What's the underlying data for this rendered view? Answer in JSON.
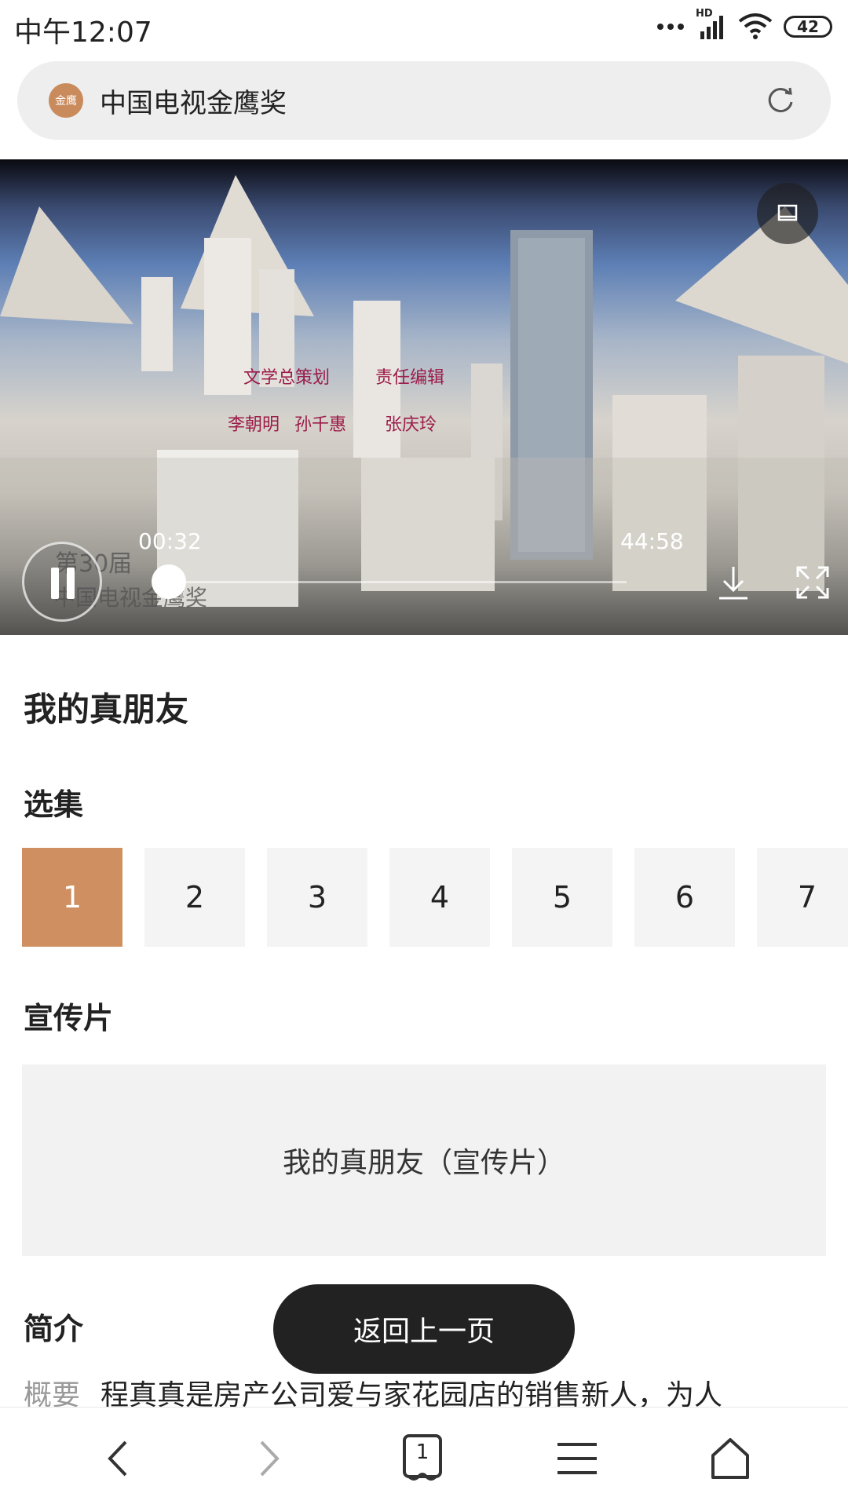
{
  "status_bar": {
    "time": "中午12:07",
    "network_badge": "HD",
    "battery": "42",
    "icons": [
      "more-dots-icon",
      "signal-icon",
      "wifi-icon",
      "battery-icon"
    ]
  },
  "address_bar": {
    "site_logo": "金鹰",
    "title": "中国电视金鹰奖",
    "reload_icon": "reload-icon"
  },
  "player": {
    "current_time": "00:32",
    "total_time": "44:58",
    "progress": 0.012,
    "controls": [
      "pause-icon",
      "download-icon",
      "fullscreen-icon",
      "picture-in-picture-icon"
    ]
  },
  "show": {
    "title": "我的真朋友"
  },
  "episodes": {
    "heading": "选集",
    "items": [
      "1",
      "2",
      "3",
      "4",
      "5",
      "6",
      "7"
    ],
    "active_index": 0
  },
  "trailer": {
    "heading": "宣传片",
    "item": "我的真朋友（宣传片）"
  },
  "intro": {
    "heading": "简介",
    "label": "概要",
    "text": "程真真是房产公司爱与家花园店的销售新人，为人"
  },
  "toast": "返回上一页",
  "bottom_nav": {
    "tab_count": "1",
    "items": [
      "back-icon",
      "forward-icon",
      "tabs-icon",
      "menu-icon",
      "home-icon"
    ]
  },
  "colors": {
    "accent": "#cf8f60",
    "toast_bg": "#222222"
  }
}
